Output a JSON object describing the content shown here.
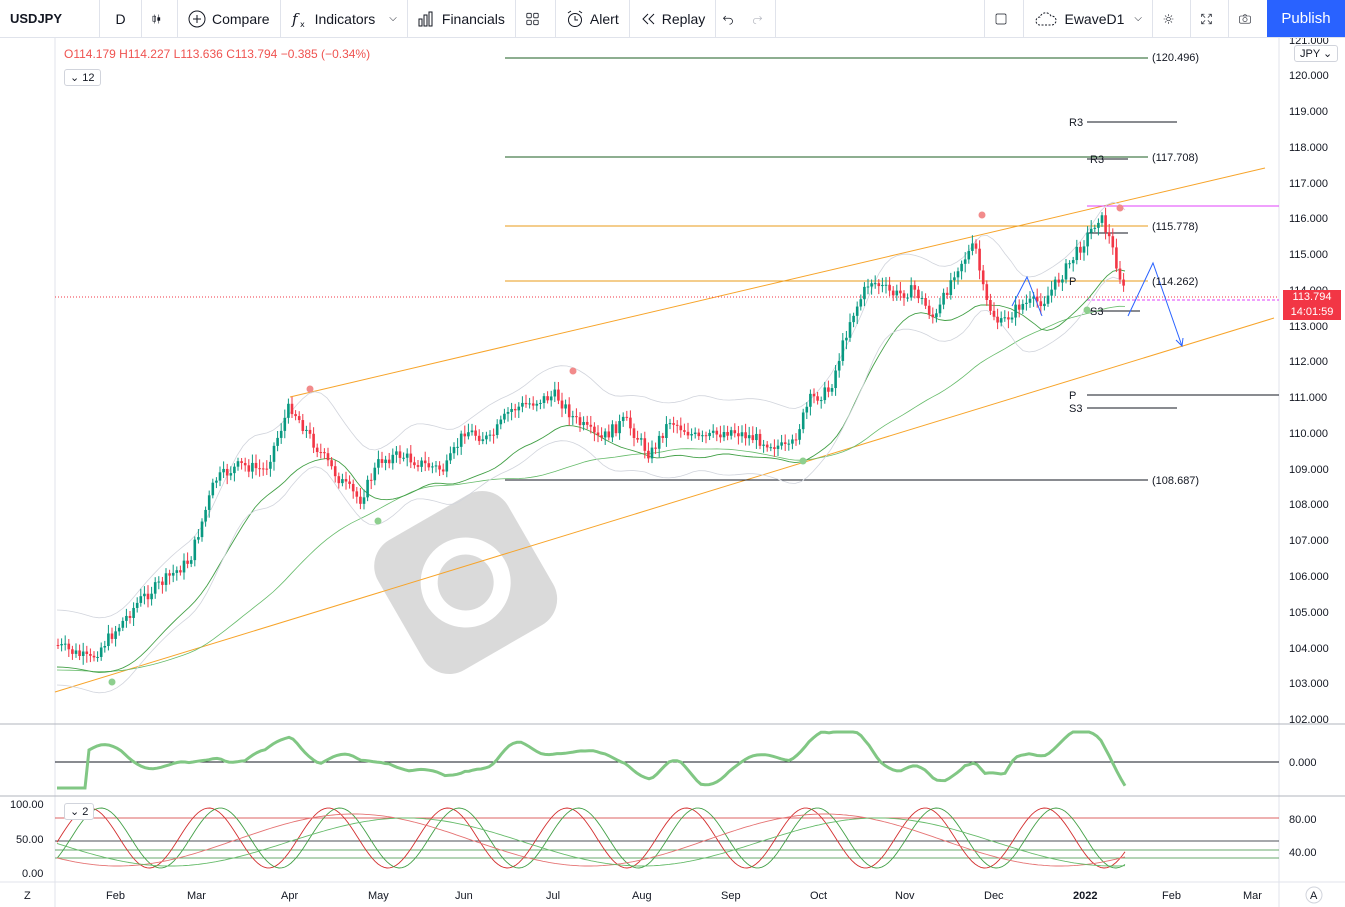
{
  "toolbar": {
    "symbol": "USDJPY",
    "interval": "D",
    "compare": "Compare",
    "indicators": "Indicators",
    "financials": "Financials",
    "alert": "Alert",
    "replay": "Replay",
    "layout_name": "EwaveD1",
    "publish": "Publish"
  },
  "legend": {
    "open": "O114.179",
    "high": "H114.227",
    "low": "L113.636",
    "close": "C113.794",
    "change": "−0.385 (−0.34%)",
    "collapsed_count": "12",
    "stoch_collapsed_count": "2"
  },
  "currency": "JPY",
  "price_axis": [
    "121.000",
    "120.000",
    "119.000",
    "118.000",
    "117.000",
    "116.000",
    "115.000",
    "114.000",
    "113.000",
    "112.000",
    "111.000",
    "110.000",
    "109.000",
    "108.000",
    "107.000",
    "106.000",
    "105.000",
    "104.000",
    "103.000",
    "102.000"
  ],
  "last_price": "113.794",
  "countdown": "14:01:59",
  "level_labels": [
    "(120.496)",
    "(117.708)",
    "(115.778)",
    "(114.262)",
    "(108.687)"
  ],
  "pivot_labels": [
    "R3",
    "R3",
    "P",
    "S3",
    "P",
    "S3"
  ],
  "osc_axis": [
    "0.000"
  ],
  "stoch_axis_left": [
    "100.00",
    "50.00",
    "0.00"
  ],
  "stoch_axis_right": [
    "80.00",
    "40.00"
  ],
  "time_axis": [
    "Feb",
    "Mar",
    "Apr",
    "May",
    "Jun",
    "Jul",
    "Aug",
    "Sep",
    "Oct",
    "Nov",
    "Dec",
    "2022",
    "Feb",
    "Mar"
  ],
  "corner_left": "Z",
  "corner_right": "A",
  "watermark": "WikiFX",
  "colors": {
    "up": "#089981",
    "down": "#f23645",
    "accent": "#2962ff",
    "channel": "#f7a42a"
  }
}
